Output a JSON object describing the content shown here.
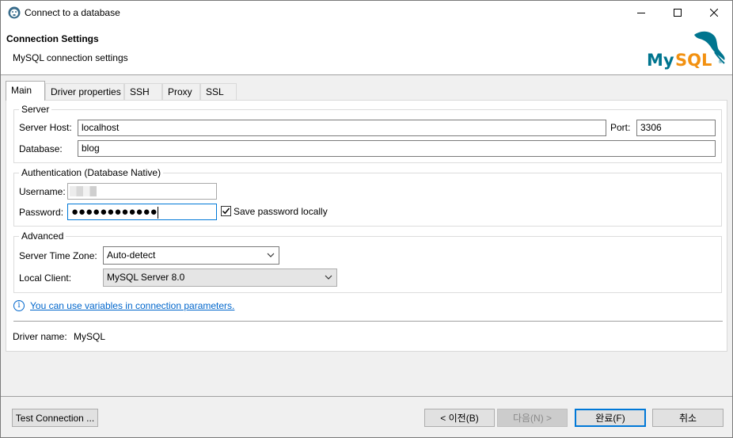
{
  "window": {
    "title": "Connect to a database"
  },
  "header": {
    "title": "Connection Settings",
    "subtitle": "MySQL connection settings",
    "logo_text": "MySQL"
  },
  "tabs": [
    {
      "label": "Main"
    },
    {
      "label": "Driver properties"
    },
    {
      "label": "SSH"
    },
    {
      "label": "Proxy"
    },
    {
      "label": "SSL"
    }
  ],
  "server": {
    "group_label": "Server",
    "host_label": "Server Host:",
    "host_value": "localhost",
    "port_label": "Port:",
    "port_value": "3306",
    "database_label": "Database:",
    "database_value": "blog"
  },
  "auth": {
    "group_label": "Authentication (Database Native)",
    "username_label": "Username:",
    "password_label": "Password:",
    "password_mask": "●●●●●●●●●●●●",
    "save_password_label": "Save password locally",
    "save_password_checked": true
  },
  "advanced": {
    "group_label": "Advanced",
    "timezone_label": "Server Time Zone:",
    "timezone_value": "Auto-detect",
    "client_label": "Local Client:",
    "client_value": "MySQL Server 8.0"
  },
  "info": {
    "text": "You can use variables in connection parameters."
  },
  "driver": {
    "label": "Driver name:",
    "value": "MySQL"
  },
  "buttons": {
    "test": "Test Connection ...",
    "back": "< 이전(B)",
    "next": "다음(N) >",
    "finish": "완료(F)",
    "cancel": "취소"
  },
  "colors": {
    "accent": "#0078d7",
    "link": "#0066cc",
    "logo_blue": "#00758f",
    "logo_orange": "#f29111"
  }
}
